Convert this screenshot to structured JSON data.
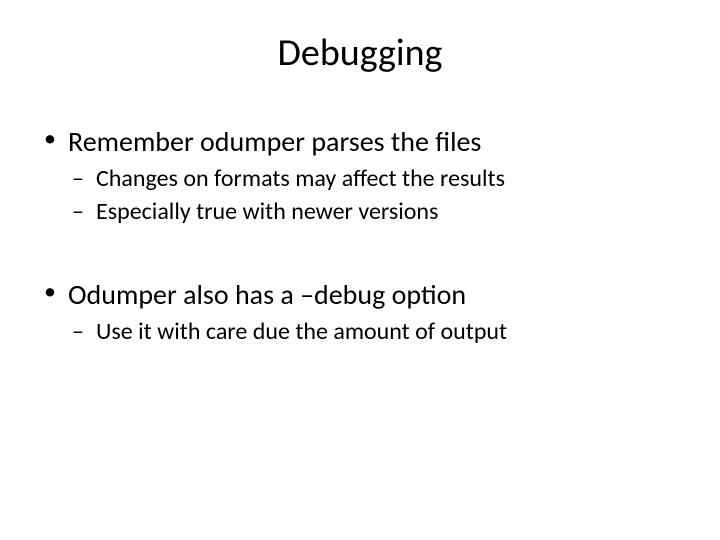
{
  "title": "Debugging",
  "bullets": [
    {
      "text": "Remember odumper parses the files",
      "children": [
        "Changes on formats may affect the results",
        "Especially true with newer versions"
      ]
    },
    {
      "text": "Odumper also has a –debug option",
      "children": [
        "Use it with care due the amount of output"
      ]
    }
  ]
}
